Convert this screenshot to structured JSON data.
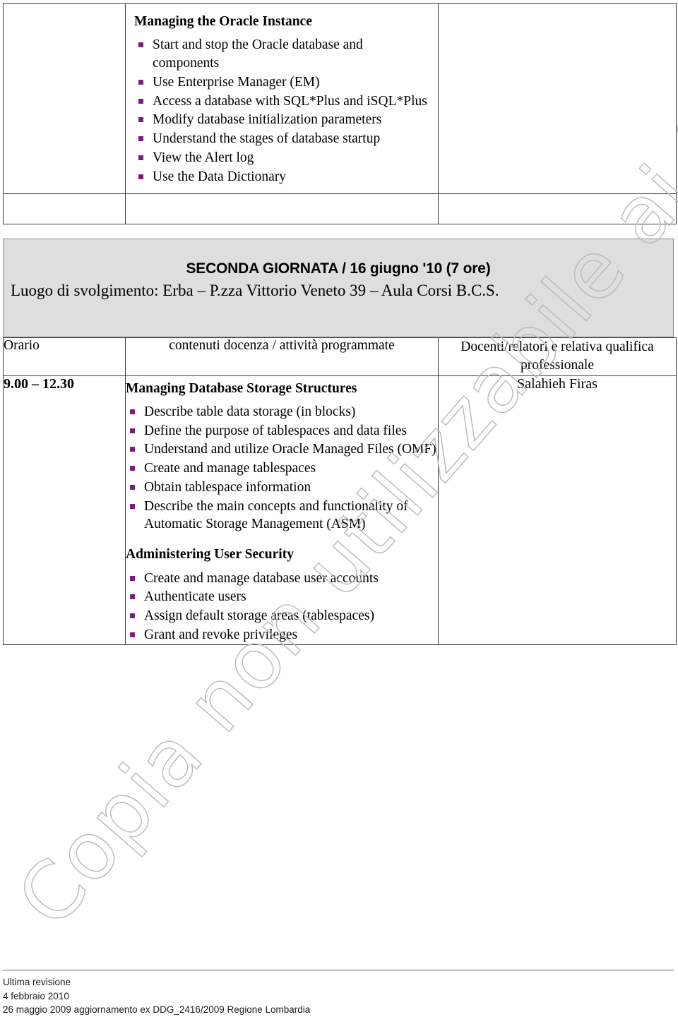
{
  "document": {
    "top_table": {
      "section_title": "Managing the Oracle Instance",
      "bullets": [
        "Start and stop the Oracle database and components",
        "Use Enterprise Manager (EM)",
        "Access a database with SQL*Plus and iSQL*Plus",
        "Modify database initialization parameters",
        "Understand the stages of database startup",
        "View the Alert log",
        "Use the Data Dictionary"
      ]
    },
    "banner": {
      "title": "SECONDA GIORNATA / 16 giugno '10 (7 ore)",
      "subtitle": "Luogo di svolgimento:  Erba – P.zza Vittorio Veneto 39 – Aula Corsi B.C.S."
    },
    "main_table": {
      "headers": {
        "time": "Orario",
        "content": "contenuti docenza / attività programmate",
        "teacher": "Docenti/relatori e relativa qualifica professionale"
      },
      "row": {
        "time": "9.00 – 12.30",
        "teacher": "Salahieh Firas",
        "section_1_title": "Managing Database Storage Structures",
        "section_1_bullets": [
          "Describe table data storage (in blocks)",
          "Define the purpose of tablespaces and data files",
          "Understand and utilize Oracle Managed Files (OMF)",
          "Create and manage tablespaces",
          "Obtain tablespace information",
          "Describe the main concepts and functionality of Automatic Storage Management (ASM)"
        ],
        "section_2_title": "Administering User Security",
        "section_2_bullets": [
          "Create and manage database user accounts",
          "Authenticate users",
          "Assign default storage areas (tablespaces)",
          "Grant and revoke privileges"
        ]
      }
    },
    "watermark": {
      "text": "Copia non utilizzabile ai fini legali",
      "color": "#b9b9b9"
    },
    "footer": {
      "line1": "Ultima revisione",
      "line2": "4 febbraio 2010",
      "line3": "26 maggio 2009 aggiornamento ex DDG_2416/2009 Regione Lombardia"
    },
    "colors": {
      "bullet": "#7b1d7b",
      "banner_bg": "#dededd",
      "border": "#3a3a3a"
    }
  }
}
